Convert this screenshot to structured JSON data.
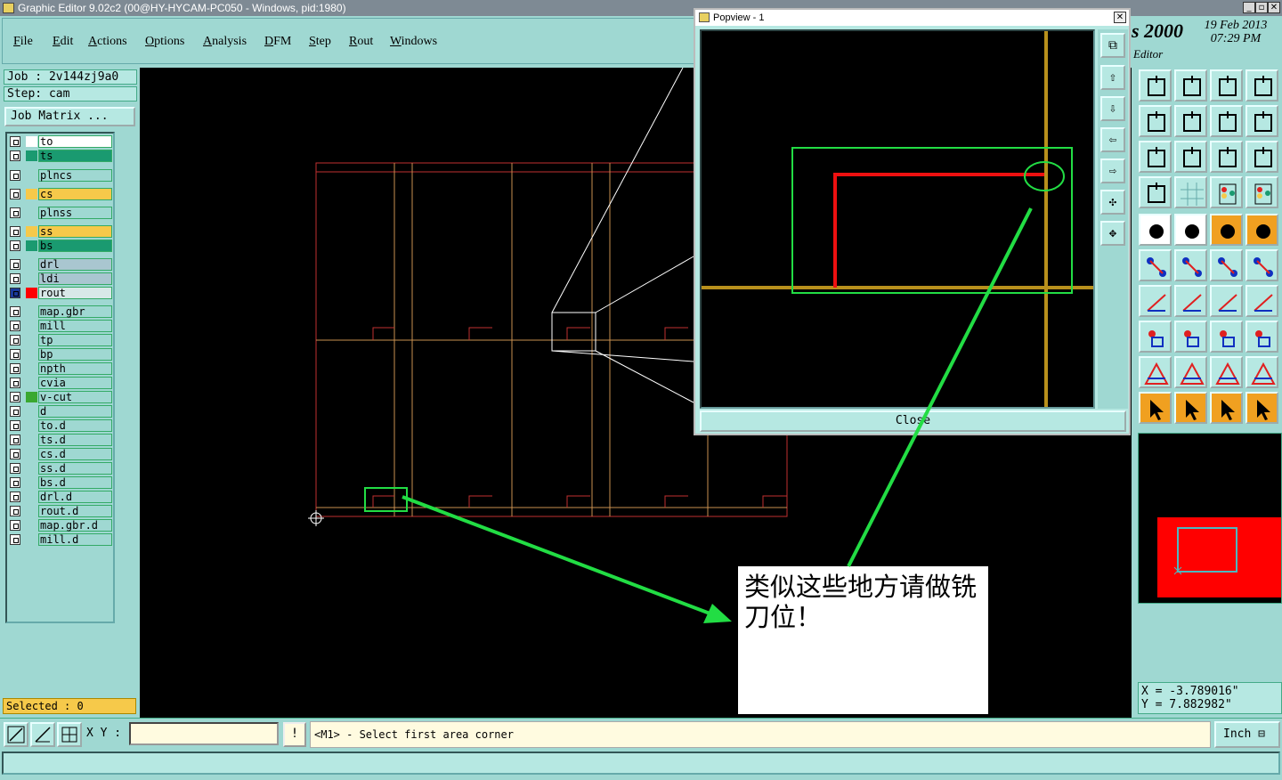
{
  "window": {
    "title": "Graphic Editor 9.02c2 (00@HY-HYCAM-PC050 - Windows, pid:1980)",
    "controls": [
      "_",
      "▫",
      "✕"
    ]
  },
  "menu": [
    "File",
    "Edit",
    "Actions",
    "Options",
    "Analysis",
    "DFM",
    "Step",
    "Rout",
    "Windows"
  ],
  "job": {
    "job_line": "Job : 2v144zj9a0",
    "step_line": "Step: cam",
    "matrix_button": "Job Matrix ..."
  },
  "layers": [
    {
      "name": "to",
      "color": "#ffffff",
      "bg": "#ffffff"
    },
    {
      "name": "ts",
      "color": "#1a9a70",
      "bg": "#1a9a70"
    },
    {
      "name": "plncs",
      "color": "",
      "bg": ""
    },
    {
      "name": "cs",
      "color": "#f6c94a",
      "bg": "#f6c94a"
    },
    {
      "name": "plnss",
      "color": "",
      "bg": ""
    },
    {
      "name": "ss",
      "color": "#f6c94a",
      "bg": "#f6c94a"
    },
    {
      "name": "bs",
      "color": "#1a9a70",
      "bg": "#1a9a70"
    },
    {
      "name": "drl",
      "color": "",
      "bg": "#a9c6d0"
    },
    {
      "name": "ldi",
      "color": "",
      "bg": "#a9c6d0"
    },
    {
      "name": "rout",
      "color": "#ff0000",
      "bg": "#d8e8e8",
      "active": true
    },
    {
      "name": "map.gbr",
      "color": "",
      "bg": ""
    },
    {
      "name": "mill",
      "color": "",
      "bg": ""
    },
    {
      "name": "tp",
      "color": "",
      "bg": ""
    },
    {
      "name": "bp",
      "color": "",
      "bg": ""
    },
    {
      "name": "npth",
      "color": "",
      "bg": ""
    },
    {
      "name": "cvia",
      "color": "",
      "bg": ""
    },
    {
      "name": "v-cut",
      "color": "#3aa830",
      "bg": ""
    },
    {
      "name": "d",
      "color": "",
      "bg": ""
    },
    {
      "name": "to.d",
      "color": "",
      "bg": ""
    },
    {
      "name": "ts.d",
      "color": "",
      "bg": ""
    },
    {
      "name": "cs.d",
      "color": "",
      "bg": ""
    },
    {
      "name": "ss.d",
      "color": "",
      "bg": ""
    },
    {
      "name": "bs.d",
      "color": "",
      "bg": ""
    },
    {
      "name": "drl.d",
      "color": "",
      "bg": ""
    },
    {
      "name": "rout.d",
      "color": "",
      "bg": ""
    },
    {
      "name": "map.gbr.d",
      "color": "",
      "bg": ""
    },
    {
      "name": "mill.d",
      "color": "",
      "bg": ""
    }
  ],
  "selected": "Selected : 0",
  "popview": {
    "title": "Popview - 1",
    "close_label": "Close"
  },
  "branding": {
    "brand": "s 2000",
    "date": "19 Feb 2013",
    "time": "07:29 PM",
    "editor": "Editor"
  },
  "coords": {
    "x": "X = -3.789016\"",
    "y": "Y = 7.882982\""
  },
  "bottom": {
    "xy_label": "X Y :",
    "xy_value": "",
    "bang": "!",
    "prompt": "<M1> - Select first area corner",
    "unit": "Inch"
  },
  "annotation": {
    "text": "类似这些地方请做铣刀位！"
  },
  "colors": {
    "panel": "#9fd8d2",
    "accent_red": "#ff0000",
    "rout_line": "#c03030",
    "outline": "#c89050",
    "highlight": "#22dd44"
  }
}
